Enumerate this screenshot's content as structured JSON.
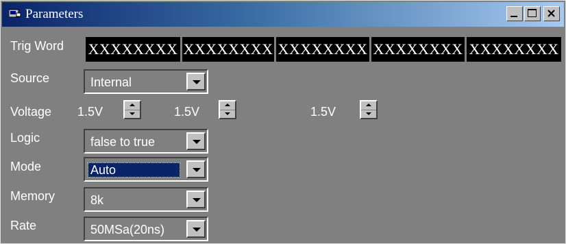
{
  "window": {
    "title": "Parameters",
    "controls": {
      "minimize": "minimize",
      "maximize": "maximize",
      "close": "close"
    }
  },
  "trig_word": {
    "label": "Trig Word",
    "fields": [
      "XXXXXXXX",
      "XXXXXXXX",
      "XXXXXXXX",
      "XXXXXXXX",
      "XXXXXXXX"
    ]
  },
  "source": {
    "label": "Source",
    "value": "Internal"
  },
  "voltage": {
    "label": "Voltage",
    "values": [
      "1.5V",
      "1.5V",
      "1.5V"
    ]
  },
  "logic": {
    "label": "Logic",
    "value": "false to true"
  },
  "mode": {
    "label": "Mode",
    "value": "Auto"
  },
  "memory": {
    "label": "Memory",
    "value": "8k"
  },
  "rate": {
    "label": "Rate",
    "value": "50MSa(20ns)"
  }
}
